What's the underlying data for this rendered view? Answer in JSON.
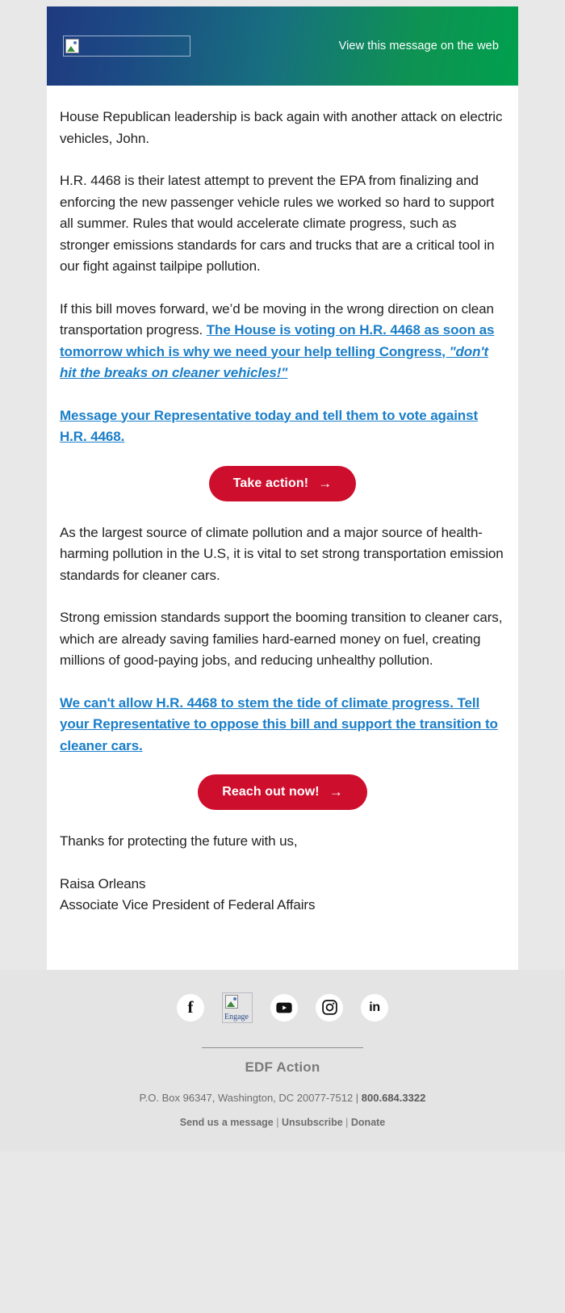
{
  "header": {
    "logo_alt": "",
    "view_web_label": "View this message on the web",
    "gradient_start": "#1f3a80",
    "gradient_end": "#00a04e"
  },
  "body": {
    "p1": "House Republican leadership is back again with another attack on electric vehicles, John.",
    "p2": "H.R. 4468 is their latest attempt to prevent the EPA from finalizing and enforcing the new passenger vehicle rules we worked so hard to support all summer. Rules that would accelerate climate progress, such as stronger emissions standards for cars and trucks that are a critical tool in our fight against tailpipe pollution.",
    "p3_plain": "If this bill moves forward, we’d be moving in the wrong direction on clean transportation progress. ",
    "p3_bold": "The House is voting on H.R. 4468 as soon as tomorrow which is why we need your help telling Congress, ",
    "p3_bold_italic": "\"don't hit the breaks on cleaner vehicles!\"",
    "cta_text_1": "Message your Representative today and tell them to vote against H.R. 4468.",
    "button_1_label": "Take action!",
    "button_1_arrow": "→",
    "p4": "As the largest source of climate pollution and a major source of health-harming pollution in the U.S, it is vital to set strong transportation emission standards for cleaner cars.",
    "p5": "Strong emission standards support the booming transition to cleaner cars, which are already saving families hard-earned money on fuel, creating millions of good-paying jobs, and reducing unhealthy pollution.",
    "cta_text_2": "We can't allow H.R. 4468 to stem the tide of climate progress. Tell your Representative to oppose this bill and support the transition to cleaner cars.",
    "button_2_label": "Reach out now!",
    "button_2_arrow": "→",
    "signoff": "Thanks for protecting the future with us,",
    "sig_name": "Raisa Orleans",
    "sig_title": "Associate Vice President of Federal Affairs",
    "link_color": "#1a7ec8",
    "button_color": "#ce0e2d"
  },
  "footer": {
    "social": [
      {
        "name": "facebook",
        "glyph": "f"
      },
      {
        "name": "engage-broken-image",
        "glyph": "",
        "alt": "Engage"
      },
      {
        "name": "youtube",
        "glyph": ""
      },
      {
        "name": "instagram",
        "glyph": ""
      },
      {
        "name": "linkedin",
        "glyph": "in"
      }
    ],
    "org_name": "EDF Action",
    "address": "P.O. Box 96347, Washington, DC 20077-7512 | ",
    "phone": "800.684.3322",
    "links": [
      {
        "label": "Send us a message"
      },
      {
        "label": "Unsubscribe"
      },
      {
        "label": "Donate"
      }
    ],
    "link_sep": " | "
  }
}
